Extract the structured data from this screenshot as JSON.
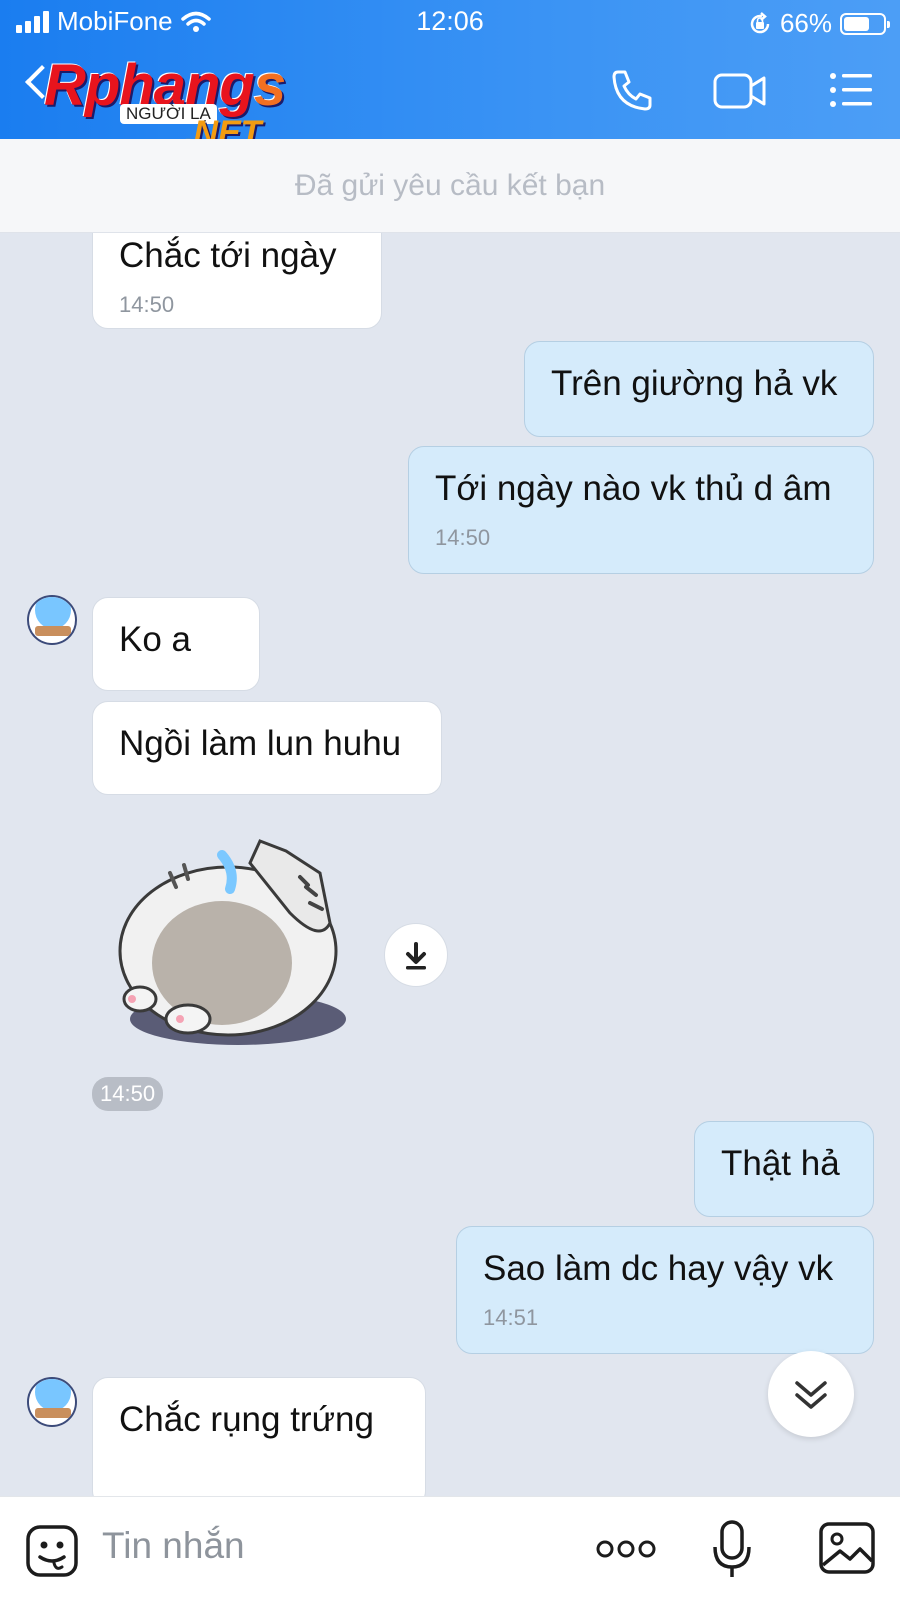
{
  "status_bar": {
    "carrier": "MobiFone",
    "time": "12:06",
    "battery": "66%",
    "battery_level": 0.66
  },
  "header": {
    "logo_main": "Rphangs",
    "logo_sub": "NGƯỜI LẠ",
    "logo_net": ".NET",
    "icons": [
      "back-icon",
      "phone-icon",
      "video-call-icon",
      "menu-list-icon"
    ]
  },
  "friend_request_notice": "Đã gửi yêu cầu kết bạn",
  "messages": [
    {
      "side": "in",
      "text": "Chắc tới ngày",
      "time": "14:50"
    },
    {
      "side": "out",
      "text": "Trên giường hả vk",
      "time": ""
    },
    {
      "side": "out",
      "text": "Tới ngày nào vk thủ d âm",
      "time": "14:50"
    },
    {
      "side": "in",
      "text": "Ko a",
      "time": ""
    },
    {
      "side": "in",
      "text": "Ngồi làm lun huhu",
      "time": ""
    },
    {
      "side": "in",
      "type": "sticker",
      "icon": "sleeping-cat-sticker"
    },
    {
      "side": "out",
      "text": "Thật hả",
      "time": ""
    },
    {
      "side": "out",
      "text": "Sao làm dc hay vậy vk",
      "time": "14:51"
    },
    {
      "side": "in",
      "text": "Chắc rụng trứng",
      "time": ""
    }
  ],
  "sticker_time": "14:50",
  "composer": {
    "placeholder": "Tin nhắn",
    "icons": [
      "sticker-emoji-icon",
      "more-options-icon",
      "microphone-icon",
      "image-gallery-icon"
    ]
  },
  "colors": {
    "header_blue": "#1a7df0",
    "chat_bg": "#e1e6ef",
    "outgoing_bubble": "#d5ebfb",
    "incoming_bubble": "#ffffff"
  }
}
